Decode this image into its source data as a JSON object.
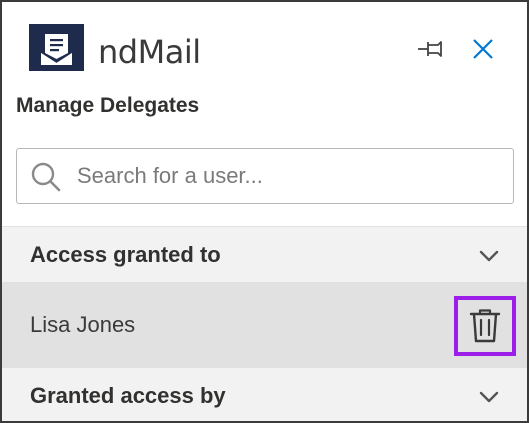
{
  "app": {
    "name": "ndMail",
    "subtitle": "Manage Delegates",
    "logo_icon": "envelope-document-icon"
  },
  "header": {
    "pin_icon": "pin-icon",
    "close_icon": "close-icon"
  },
  "search": {
    "placeholder": "Search for a user...",
    "value": "",
    "icon": "search-icon"
  },
  "sections": [
    {
      "label": "Access granted to",
      "expanded": true,
      "items": [
        {
          "name": "Lisa Jones",
          "action_icon": "trash-icon"
        }
      ]
    },
    {
      "label": "Granted access by",
      "expanded": false,
      "items": []
    }
  ],
  "colors": {
    "logo_bg": "#1f2b4d",
    "accent": "#0078d4",
    "highlight": "#9b1fe8",
    "section_bg": "#f2f2f2",
    "row_bg": "#e1e1e1"
  }
}
